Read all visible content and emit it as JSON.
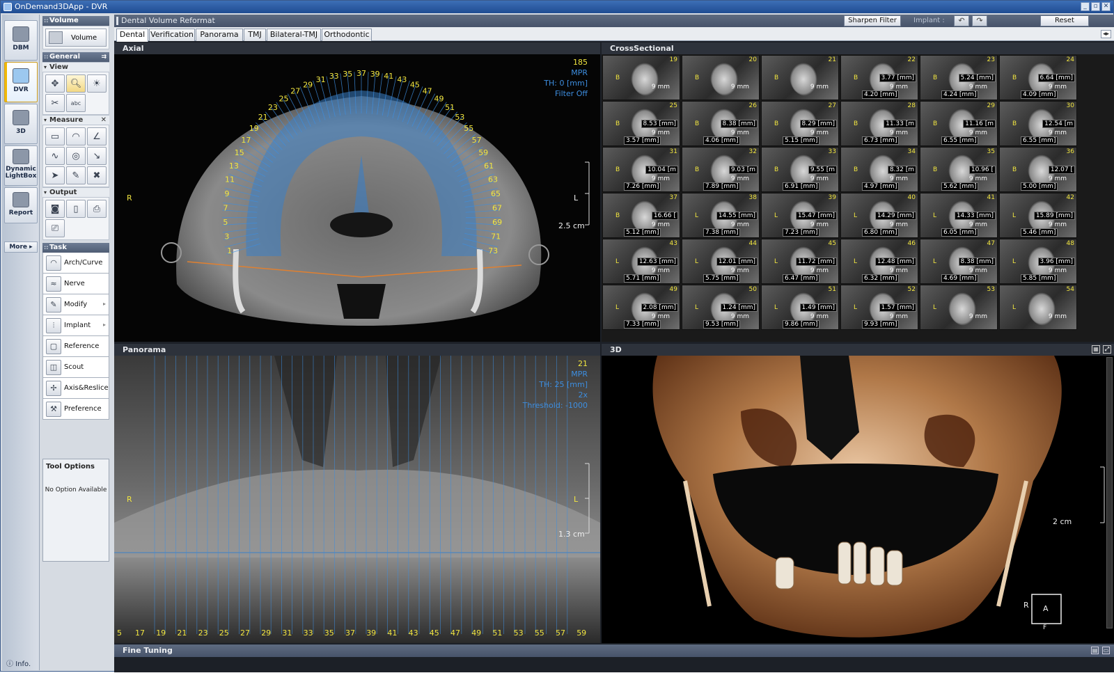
{
  "app": {
    "title": "OnDemand3DApp - DVR",
    "window_buttons": [
      "_",
      "▫",
      "✕"
    ]
  },
  "rail": {
    "items": [
      {
        "label": "DBM"
      },
      {
        "label": "DVR"
      },
      {
        "label": "3D"
      },
      {
        "label": "Dynamic\nLightBox"
      },
      {
        "label": "Report"
      }
    ],
    "more": "More",
    "info": "Info."
  },
  "tools": {
    "volume_header": "Volume",
    "volume_button": "Volume",
    "general_header": "General",
    "view_header": "View",
    "measure_header": "Measure",
    "output_header": "Output",
    "task_header": "Task",
    "tasks": [
      {
        "label": "Arch/Curve",
        "icon": "arch-icon"
      },
      {
        "label": "Nerve",
        "icon": "nerve-icon"
      },
      {
        "label": "Modify",
        "icon": "modify-icon"
      },
      {
        "label": "Implant",
        "icon": "implant-icon"
      },
      {
        "label": "Reference",
        "icon": "reference-icon"
      },
      {
        "label": "Scout",
        "icon": "scout-icon"
      },
      {
        "label": "Axis&Reslice",
        "icon": "axis-reslice-icon"
      },
      {
        "label": "Preference",
        "icon": "preference-icon"
      }
    ],
    "tool_options_header": "Tool Options",
    "tool_options_body": "No Option Available"
  },
  "workflow": {
    "title": "Dental Volume Reformat",
    "sharpen": "Sharpen Filter",
    "implant_label": "Implant :",
    "reset": "Reset"
  },
  "tabs": [
    "Dental",
    "Verification",
    "Panorama",
    "TMJ",
    "Bilateral-TMJ",
    "Orthodontic"
  ],
  "axial": {
    "title": "Axial",
    "slice": "185",
    "mode": "MPR",
    "th": "TH: 0 [mm]",
    "filter": "Filter Off",
    "left_label": "R",
    "right_label": "L",
    "scale": "2.5 cm",
    "arch_numbers": [
      "1",
      "3",
      "5",
      "7",
      "9",
      "11",
      "13",
      "15",
      "17",
      "19",
      "21",
      "23",
      "25",
      "27",
      "29",
      "31",
      "33",
      "35",
      "37",
      "39",
      "41",
      "43",
      "45",
      "47",
      "49",
      "51",
      "53",
      "55",
      "57",
      "59",
      "61",
      "63",
      "65",
      "67",
      "69",
      "71",
      "73"
    ]
  },
  "cross": {
    "title": "CrossSectional",
    "cells": [
      {
        "n": "19",
        "m1": "",
        "m2": "",
        "side": "B"
      },
      {
        "n": "20",
        "m1": "",
        "m2": "",
        "side": "B"
      },
      {
        "n": "21",
        "m1": "",
        "m2": "",
        "side": "B"
      },
      {
        "n": "22",
        "m1": "3.77 [mm]",
        "m2": "4.20 [mm]",
        "side": "B"
      },
      {
        "n": "23",
        "m1": "5.24 [mm]",
        "m2": "4.24 [mm]",
        "side": "B"
      },
      {
        "n": "24",
        "m1": "6.64 [mm]",
        "m2": "4.09 [mm]",
        "side": "B"
      },
      {
        "n": "25",
        "m1": "8.53 [mm]",
        "m2": "3.57 [mm]",
        "side": "B"
      },
      {
        "n": "26",
        "m1": "8.38 [mm]",
        "m2": "4.06 [mm]",
        "side": "B"
      },
      {
        "n": "27",
        "m1": "8.29 [mm]",
        "m2": "5.15 [mm]",
        "side": "B"
      },
      {
        "n": "28",
        "m1": "11.33 [m",
        "m2": "6.73 [mm]",
        "side": "B"
      },
      {
        "n": "29",
        "m1": "11.16 [m",
        "m2": "6.55 [mm]",
        "side": "B"
      },
      {
        "n": "30",
        "m1": "12.54 [m",
        "m2": "6.55 [mm]",
        "side": "B"
      },
      {
        "n": "31",
        "m1": "10.04 [m",
        "m2": "7.26 [mm]",
        "side": "B"
      },
      {
        "n": "32",
        "m1": "9.03 [m",
        "m2": "7.89 [mm]",
        "side": "B"
      },
      {
        "n": "33",
        "m1": "9.55 [m",
        "m2": "6.91 [mm]",
        "side": "B"
      },
      {
        "n": "34",
        "m1": "8.32 [m",
        "m2": "4.97 [mm]",
        "side": "B"
      },
      {
        "n": "35",
        "m1": "10.96 [",
        "m2": "5.62 [mm]",
        "side": "B"
      },
      {
        "n": "36",
        "m1": "12.07 [",
        "m2": "5.00 [mm]",
        "side": "B"
      },
      {
        "n": "37",
        "m1": "16.66 [",
        "m2": "5.12 [mm]",
        "side": "B"
      },
      {
        "n": "38",
        "m1": "14.55 [mm]",
        "m2": "7.38 [mm]",
        "side": "L"
      },
      {
        "n": "39",
        "m1": "15.47 [mm]",
        "m2": "7.23 [mm]",
        "side": "L"
      },
      {
        "n": "40",
        "m1": "14.29 [mm]",
        "m2": "6.80 [mm]",
        "side": "L"
      },
      {
        "n": "41",
        "m1": "14.33 [mm]",
        "m2": "6.05 [mm]",
        "side": "L"
      },
      {
        "n": "42",
        "m1": "15.89 [mm]",
        "m2": "5.46 [mm]",
        "side": "L"
      },
      {
        "n": "43",
        "m1": "12.63 [mm]",
        "m2": "5.71 [mm]",
        "side": "L"
      },
      {
        "n": "44",
        "m1": "12.01 [mm]",
        "m2": "5.75 [mm]",
        "side": "L"
      },
      {
        "n": "45",
        "m1": "11.72 [mm]",
        "m2": "6.47 [mm]",
        "side": "L"
      },
      {
        "n": "46",
        "m1": "12.48 [mm]",
        "m2": "6.32 [mm]",
        "side": "L"
      },
      {
        "n": "47",
        "m1": "8.38 [mm]",
        "m2": "4.69 [mm]",
        "side": "L"
      },
      {
        "n": "48",
        "m1": "3.96 [mm]",
        "m2": "5.85 [mm]",
        "side": "L"
      },
      {
        "n": "49",
        "m1": "2.08 [mm]",
        "m2": "7.33 [mm]",
        "side": "L"
      },
      {
        "n": "50",
        "m1": "1.24 [mm]",
        "m2": "9.53 [mm]",
        "side": "L"
      },
      {
        "n": "51",
        "m1": "1.49 [mm]",
        "m2": "9.86 [mm]",
        "side": "L"
      },
      {
        "n": "52",
        "m1": "1.57 [mm]",
        "m2": "9.93 [mm]",
        "side": "L"
      },
      {
        "n": "53",
        "m1": "",
        "m2": "",
        "side": "L"
      },
      {
        "n": "54",
        "m1": "",
        "m2": "",
        "side": "L"
      }
    ],
    "cell_depth": "9 mm"
  },
  "panorama": {
    "title": "Panorama",
    "slice": "21",
    "mode": "MPR",
    "th": "TH: 25 [mm]",
    "zoom": "2x",
    "threshold": "Threshold: -1000",
    "left_label": "R",
    "right_label": "L",
    "scale": "1.3 cm",
    "ruler": [
      "5",
      "17",
      "19",
      "21",
      "23",
      "25",
      "27",
      "29",
      "31",
      "33",
      "35",
      "37",
      "39",
      "41",
      "43",
      "45",
      "47",
      "49",
      "51",
      "53",
      "55",
      "57",
      "59"
    ]
  },
  "three_d": {
    "title": "3D",
    "scale": "2 cm",
    "orient_r": "R",
    "orient_a": "A",
    "orient_f": "F"
  },
  "fine": {
    "title": "Fine Tuning"
  },
  "colors": {
    "overlay_blue": "#3d8ee0",
    "arch_yellow": "#f2e640",
    "active_gold": "#f2b900"
  }
}
